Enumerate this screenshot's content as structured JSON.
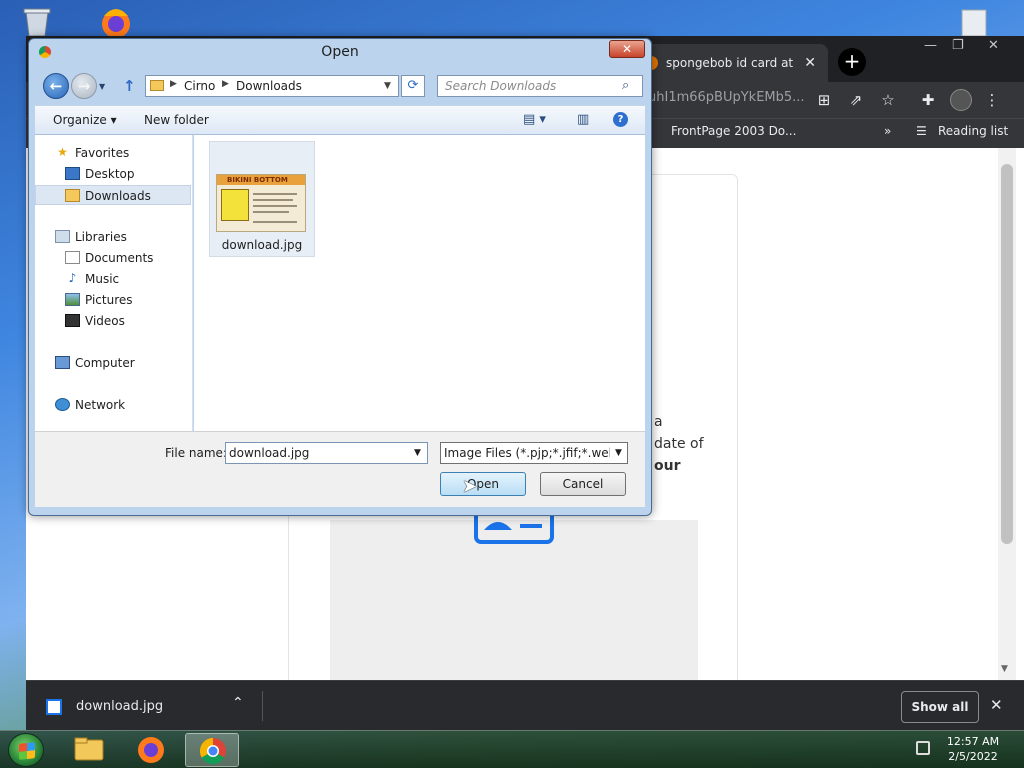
{
  "browser": {
    "tabs": [
      {
        "label": "",
        "active": false
      },
      {
        "label": "",
        "active": false
      },
      {
        "label": "spongebob id card at Du",
        "active": true
      }
    ],
    "url": "uhI1m66pBUpYkEMb5...",
    "bookmarks": [
      {
        "label": "FrontPage 2003 Do..."
      },
      {
        "label": "»"
      },
      {
        "label": "Reading list"
      }
    ],
    "page_text": [
      "a",
      "date of",
      "our"
    ],
    "download": {
      "filename": "download.jpg",
      "show_all": "Show all"
    }
  },
  "dialog": {
    "title": "Open",
    "address": {
      "crumbs": [
        "Cirno",
        "Downloads"
      ]
    },
    "search_placeholder": "Search Downloads",
    "toolbar": {
      "organize": "Organize ▾",
      "new_folder": "New folder"
    },
    "nav": {
      "favorites": {
        "label": "Favorites",
        "items": [
          {
            "label": "Desktop"
          },
          {
            "label": "Downloads",
            "selected": true
          }
        ]
      },
      "libraries": {
        "label": "Libraries",
        "items": [
          {
            "label": "Documents"
          },
          {
            "label": "Music"
          },
          {
            "label": "Pictures"
          },
          {
            "label": "Videos"
          }
        ]
      },
      "computer": {
        "label": "Computer"
      },
      "network": {
        "label": "Network"
      }
    },
    "files": [
      {
        "name": "download.jpg",
        "thumb_header": "BIKINI BOTTOM"
      }
    ],
    "filename_label": "File name:",
    "filename_value": "download.jpg",
    "filter_value": "Image Files (*.pjp;*.jfif;*.webp;*",
    "open_label": "Open",
    "cancel_label": "Cancel"
  },
  "taskbar": {
    "time": "12:57 AM",
    "date": "2/5/2022"
  },
  "colors": {
    "dialog_frame": "#bcd3ee",
    "accent": "#1a73e8",
    "chrome_dark": "#202124"
  },
  "icons": [
    "folder-icon",
    "firefox-icon",
    "chrome-icon",
    "windows-start-icon",
    "star-icon",
    "puzzle-icon"
  ]
}
